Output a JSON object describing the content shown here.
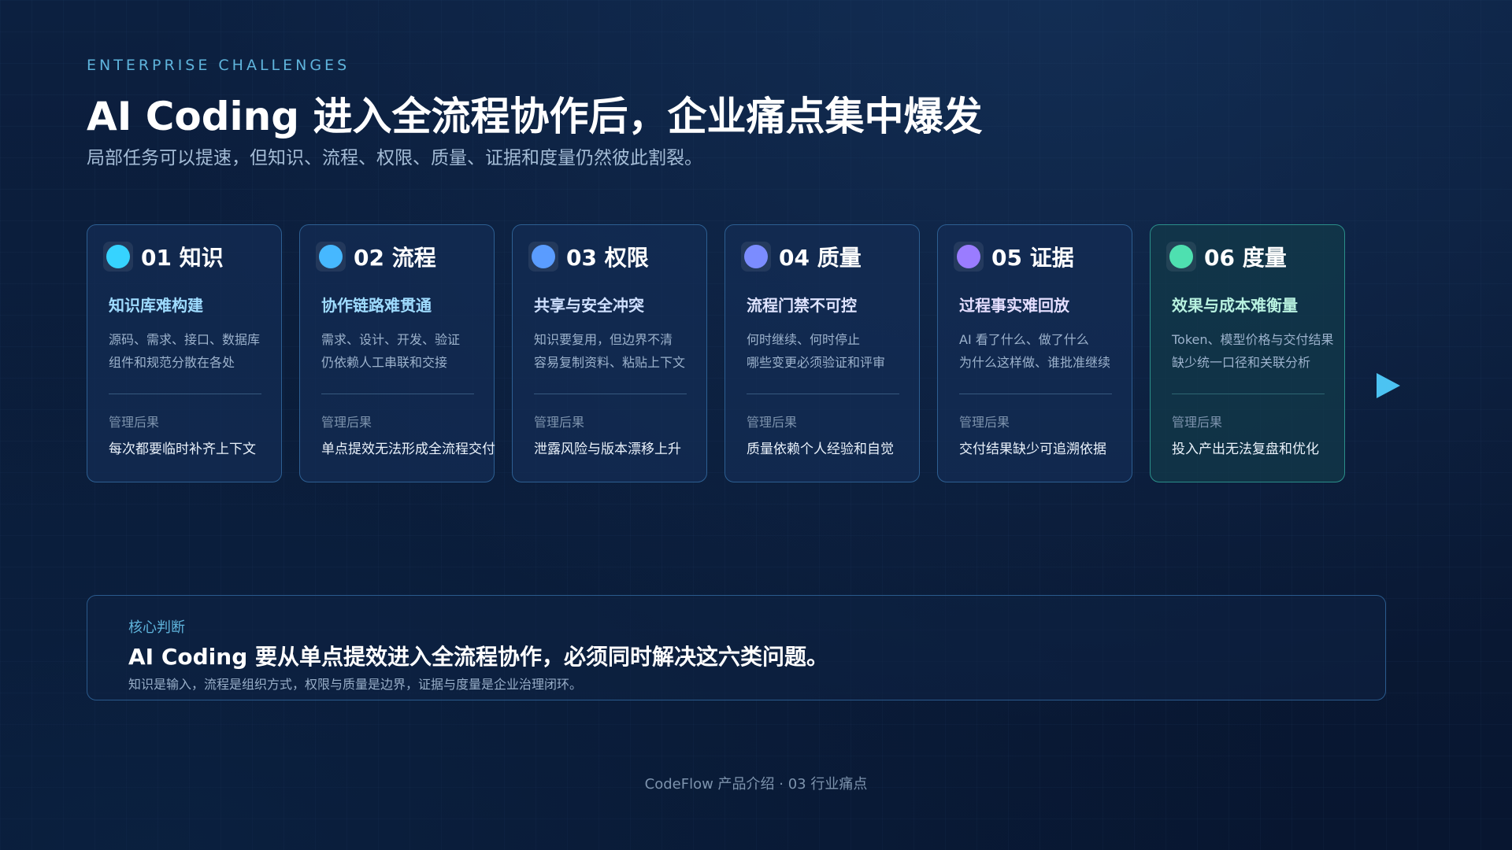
{
  "header": {
    "eyebrow": "ENTERPRISE CHALLENGES",
    "title": "AI Coding 进入全流程协作后，企业痛点集中爆发",
    "subtitle": "局部任务可以提速，但知识、流程、权限、质量、证据和度量仍然彼此割裂。"
  },
  "cards": [
    {
      "number": "01",
      "title": "01 知识",
      "subtitle": "知识库难构建",
      "desc": [
        "源码、需求、接口、数据库",
        "组件和规范分散在各处"
      ],
      "impact_label": "管理后果",
      "impact": "每次都要临时补齐上下文",
      "dot_color": "#36d3ff",
      "subtitle_color": "#9fdcff"
    },
    {
      "number": "02",
      "title": "02 流程",
      "subtitle": "协作链路难贯通",
      "desc": [
        "需求、设计、开发、验证",
        "仍依赖人工串联和交接"
      ],
      "impact_label": "管理后果",
      "impact": "单点提效无法形成全流程交付",
      "dot_color": "#46b8ff",
      "subtitle_color": "#9fdcff"
    },
    {
      "number": "03",
      "title": "03 权限",
      "subtitle": "共享与安全冲突",
      "desc": [
        "知识要复用，但边界不清",
        "容易复制资料、粘贴上下文"
      ],
      "impact_label": "管理后果",
      "impact": "泄露风险与版本漂移上升",
      "dot_color": "#5a9cff",
      "subtitle_color": "#cfe0ff"
    },
    {
      "number": "04",
      "title": "04 质量",
      "subtitle": "流程门禁不可控",
      "desc": [
        "何时继续、何时停止",
        "哪些变更必须验证和评审"
      ],
      "impact_label": "管理后果",
      "impact": "质量依赖个人经验和自觉",
      "dot_color": "#7b8cff",
      "subtitle_color": "#dfe4ff"
    },
    {
      "number": "05",
      "title": "05 证据",
      "subtitle": "过程事实难回放",
      "desc": [
        "AI 看了什么、做了什么",
        "为什么这样做、谁批准继续"
      ],
      "impact_label": "管理后果",
      "impact": "交付结果缺少可追溯依据",
      "dot_color": "#9a7cff",
      "subtitle_color": "#e4deff"
    },
    {
      "number": "06",
      "title": "06 度量",
      "subtitle": "效果与成本难衡量",
      "desc": [
        "Token、模型价格与交付结果",
        "缺少统一口径和关联分析"
      ],
      "impact_label": "管理后果",
      "impact": "投入产出无法复盘和优化",
      "dot_color": "#4ee0b0",
      "subtitle_color": "#b8f2e0"
    }
  ],
  "judgment": {
    "label": "核心判断",
    "title": "AI Coding 要从单点提效进入全流程协作，必须同时解决这六类问题。",
    "note": "知识是输入，流程是组织方式，权限与质量是边界，证据与度量是企业治理闭环。"
  },
  "footer": "CodeFlow 产品介绍 · 03 行业痛点",
  "icons": {
    "next": "play-arrow-icon"
  }
}
